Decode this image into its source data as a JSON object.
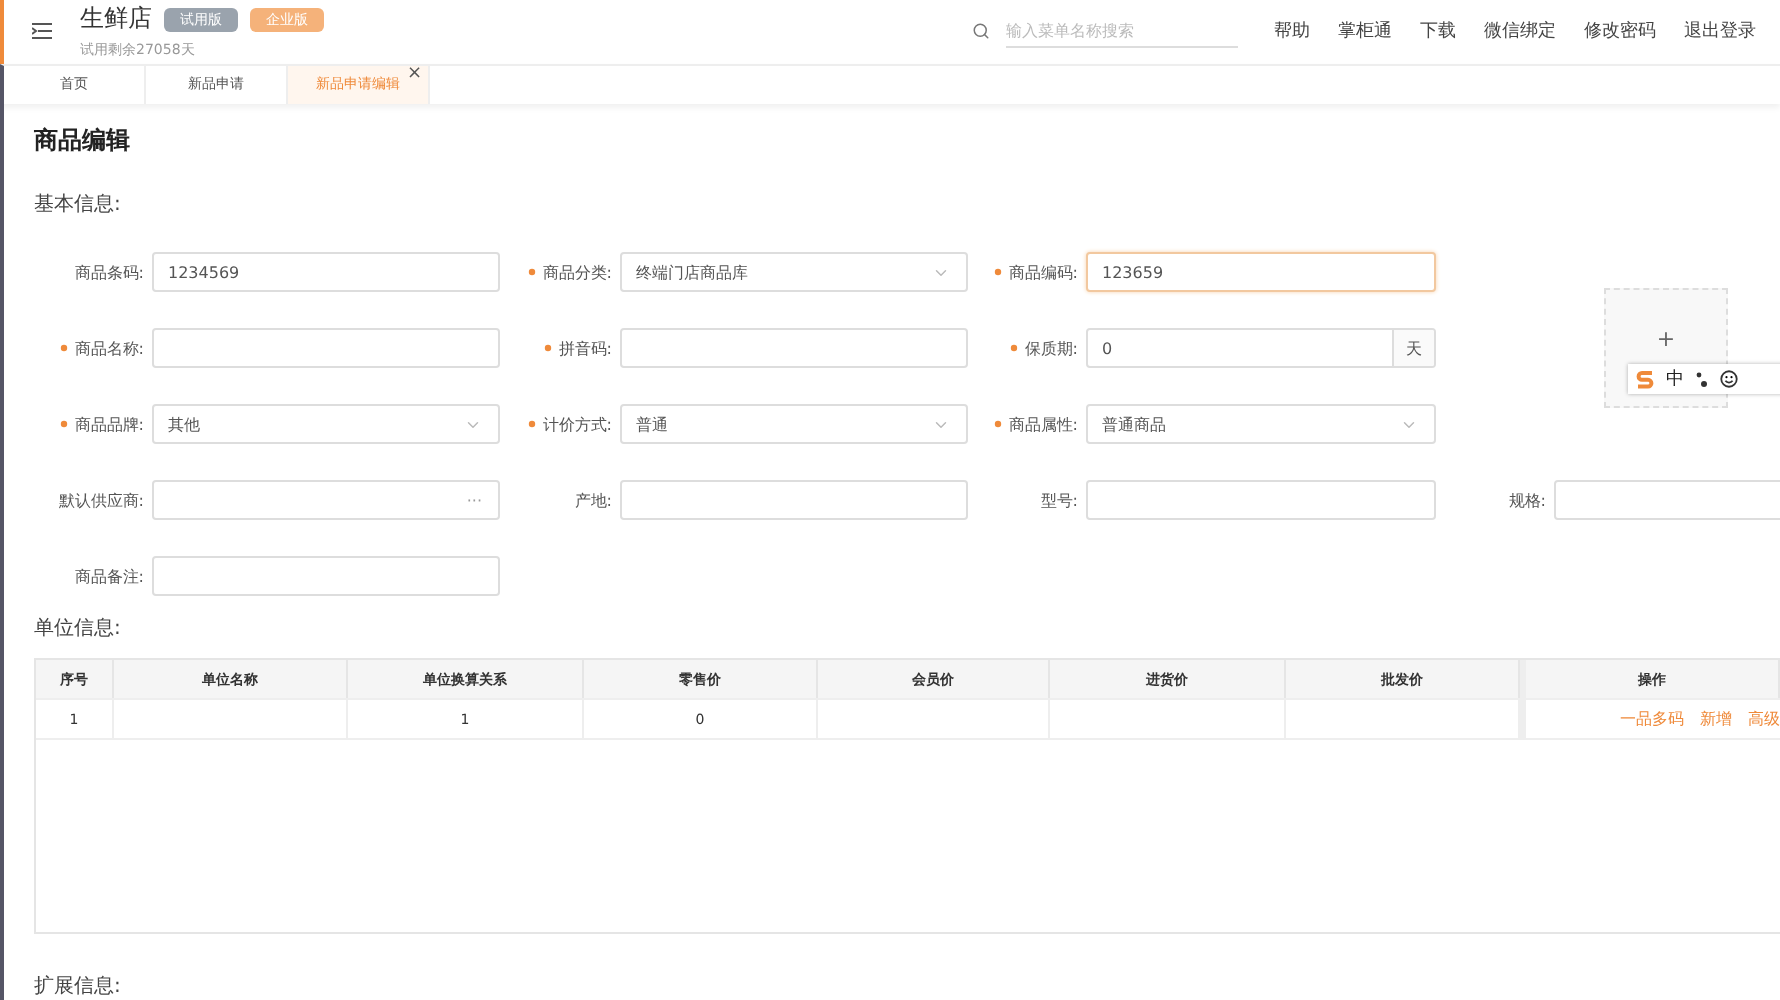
{
  "header": {
    "store_name": "生鲜店",
    "badges": [
      {
        "kind": "trial",
        "label": "试用版"
      },
      {
        "kind": "enterprise",
        "label": "企业版"
      }
    ],
    "trial_text": "试用剩余27058天",
    "search": {
      "placeholder": "输入菜单名称搜索"
    },
    "links": [
      "帮助",
      "掌柜通",
      "下载",
      "微信绑定",
      "修改密码",
      "退出登录"
    ]
  },
  "tabs": [
    {
      "label": "首页",
      "selected": false
    },
    {
      "label": "新品申请",
      "selected": false
    },
    {
      "label": "新品申请编辑",
      "selected": true,
      "close": "×"
    }
  ],
  "page_title": "商品编辑",
  "basic_info": {
    "title": "基本信息:",
    "rows": [
      [
        {
          "kind": "text",
          "label": "商品条码:",
          "required": false,
          "value": "1234569",
          "focused": false
        },
        {
          "kind": "select",
          "label": "商品分类:",
          "required": true,
          "value": "终端门店商品库",
          "focused": false
        },
        {
          "kind": "text",
          "label": "商品编码:",
          "required": true,
          "value": "123659",
          "focused": true
        }
      ],
      [
        {
          "kind": "text",
          "label": "商品名称:",
          "required": true,
          "focused": false
        },
        {
          "kind": "text",
          "label": "拼音码:",
          "required": true,
          "focused": false
        },
        {
          "kind": "suffix",
          "label": "保质期:",
          "required": true,
          "value": "0",
          "suffix": "天",
          "focused": false
        }
      ],
      [
        {
          "kind": "select",
          "label": "商品品牌:",
          "required": true,
          "value": "其他",
          "focused": false
        },
        {
          "kind": "select",
          "label": "计价方式:",
          "required": true,
          "value": "普通",
          "focused": false
        },
        {
          "kind": "select",
          "label": "商品属性:",
          "required": true,
          "value": "普通商品",
          "focused": false
        }
      ],
      [
        {
          "kind": "lookup",
          "label": "默认供应商:",
          "required": false,
          "lookup": "···",
          "focused": false
        },
        {
          "kind": "text",
          "label": "产地:",
          "required": false,
          "focused": false
        },
        {
          "kind": "text",
          "label": "型号:",
          "required": false,
          "focused": false
        },
        {
          "kind": "text",
          "label": "规格:",
          "required": false,
          "focused": false
        }
      ],
      [
        {
          "kind": "text",
          "label": "商品备注:",
          "required": false,
          "focused": false
        }
      ]
    ],
    "upload": {
      "glyph": "+"
    },
    "ime_bar": {
      "label": "中"
    }
  },
  "unit_info": {
    "title": "单位信息:",
    "columns": [
      "序号",
      "单位名称",
      "单位换算关系",
      "零售价",
      "会员价",
      "进货价",
      "批发价",
      "操作"
    ],
    "rows": [
      {
        "cells": [
          "1",
          "",
          "1",
          "0",
          "",
          "",
          ""
        ],
        "actions": [
          "一品多码",
          "新增",
          "高级"
        ]
      }
    ]
  },
  "extended_info": {
    "title": "扩展信息:"
  }
}
